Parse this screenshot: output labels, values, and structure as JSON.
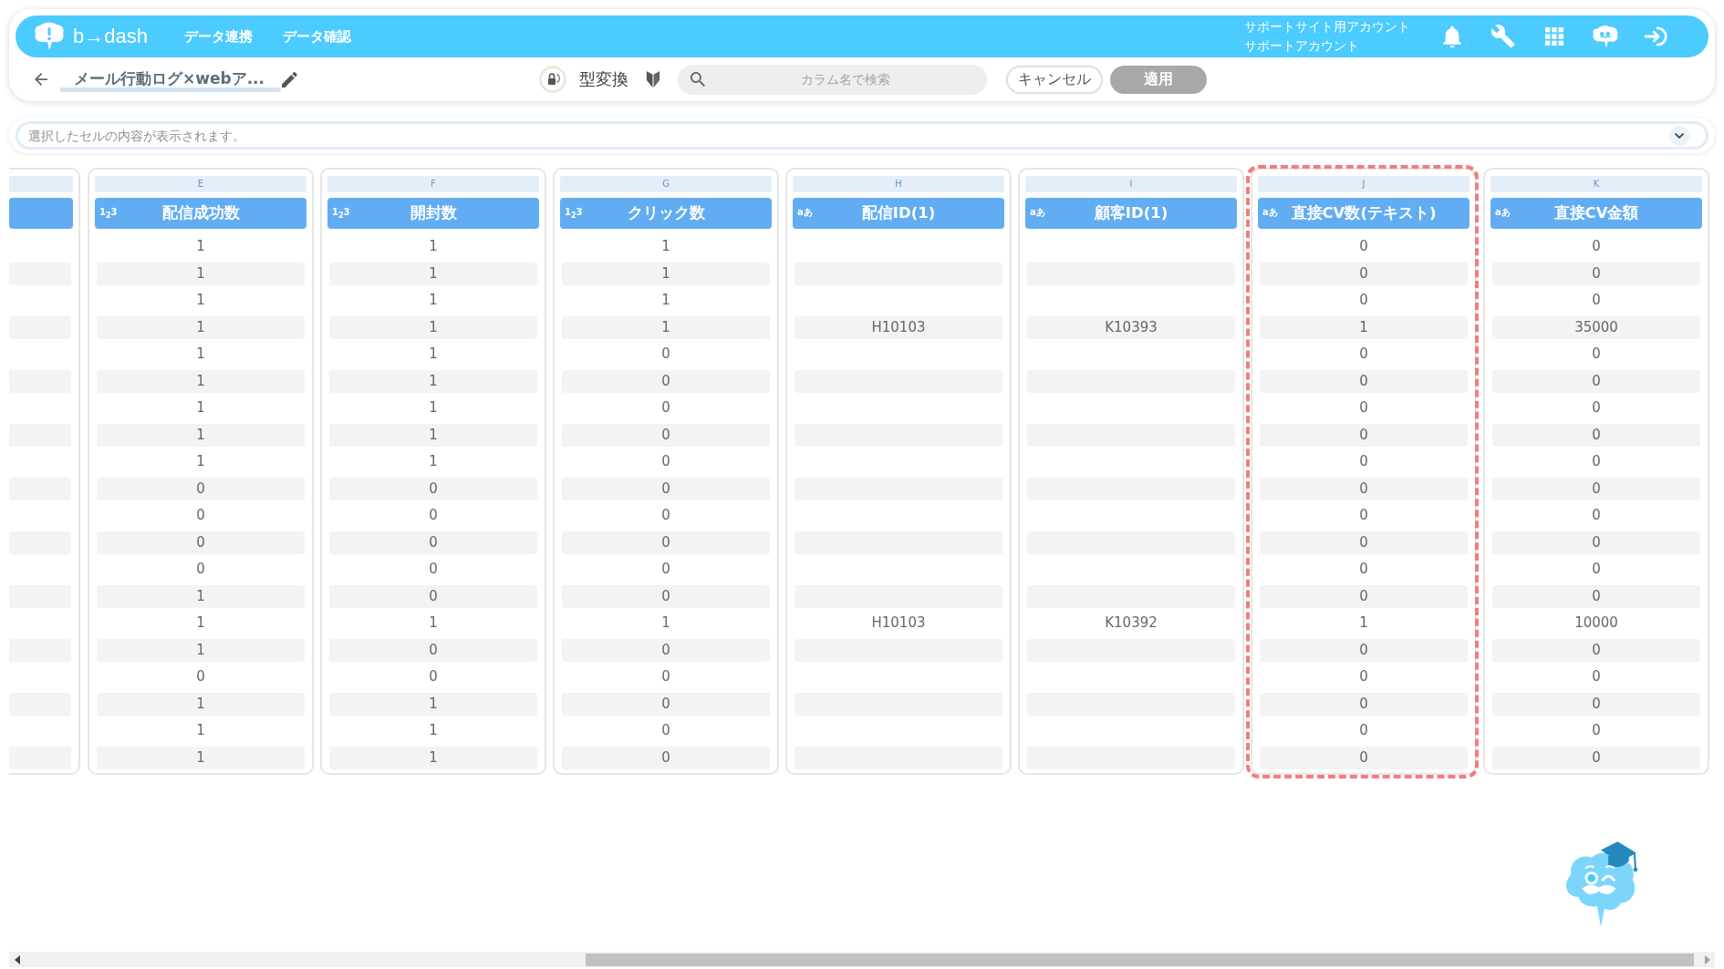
{
  "header": {
    "brand": "b→dash",
    "nav": [
      {
        "label": "データ連携"
      },
      {
        "label": "データ確認"
      }
    ],
    "account": {
      "site": "サポートサイト用アカウント",
      "name": "サポートアカウント"
    }
  },
  "toolbar": {
    "title": "メール行動ログ×webア...",
    "convert_label": "型変換",
    "search": {
      "placeholder": "カラム名で検索"
    },
    "buttons": [
      {
        "label": "キャンセル",
        "disabled": false
      },
      {
        "label": "適用",
        "disabled": true
      }
    ]
  },
  "cell_viewer": {
    "placeholder": "選択したセルの内容が表示されます。"
  },
  "table": {
    "columns": [
      {
        "letter": "E",
        "type_icon": "1$_{2}$3",
        "header": "配信成功数",
        "highlighted": false,
        "cells": [
          "1",
          "1",
          "1",
          "1",
          "1",
          "1",
          "1",
          "1",
          "1",
          "0",
          "0",
          "0",
          "0",
          "1",
          "1",
          "1",
          "0",
          "1",
          "1",
          "1"
        ]
      },
      {
        "letter": "F",
        "type_icon": "1$_{2}$3",
        "header": "開封数",
        "highlighted": false,
        "cells": [
          "1",
          "1",
          "1",
          "1",
          "1",
          "1",
          "1",
          "1",
          "1",
          "0",
          "0",
          "0",
          "0",
          "0",
          "1",
          "0",
          "0",
          "1",
          "1",
          "1"
        ]
      },
      {
        "letter": "G",
        "type_icon": "1$_{2}$3",
        "header": "クリック数",
        "highlighted": false,
        "cells": [
          "1",
          "1",
          "1",
          "1",
          "0",
          "0",
          "0",
          "0",
          "0",
          "0",
          "0",
          "0",
          "0",
          "0",
          "1",
          "0",
          "0",
          "0",
          "0",
          "0"
        ]
      },
      {
        "letter": "H",
        "type_icon": "aあ",
        "header": "配信ID(1)",
        "highlighted": false,
        "cells": [
          null,
          null,
          null,
          "H10103",
          null,
          null,
          null,
          null,
          null,
          null,
          null,
          null,
          null,
          null,
          "H10103",
          null,
          null,
          null,
          null,
          null
        ]
      },
      {
        "letter": "I",
        "type_icon": "aあ",
        "header": "顧客ID(1)",
        "highlighted": false,
        "cells": [
          null,
          null,
          null,
          "K10393",
          null,
          null,
          null,
          null,
          null,
          null,
          null,
          null,
          null,
          null,
          "K10392",
          null,
          null,
          null,
          null,
          null
        ]
      },
      {
        "letter": "J",
        "type_icon": "aあ",
        "header": "直接CV数(テキスト)",
        "highlighted": true,
        "cells": [
          "0",
          "0",
          "0",
          "1",
          "0",
          "0",
          "0",
          "0",
          "0",
          "0",
          "0",
          "0",
          "0",
          "0",
          "1",
          "0",
          "0",
          "0",
          "0",
          "0"
        ]
      },
      {
        "letter": "K",
        "type_icon": "aあ",
        "header": "直接CV金額",
        "highlighted": false,
        "cells": [
          "0",
          "0",
          "0",
          "35000",
          "0",
          "0",
          "0",
          "0",
          "0",
          "0",
          "0",
          "0",
          "0",
          "0",
          "10000",
          "0",
          "0",
          "0",
          "0",
          "0"
        ]
      }
    ]
  }
}
